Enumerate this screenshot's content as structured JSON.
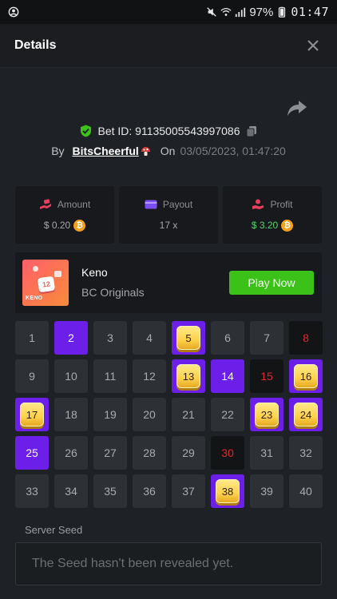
{
  "status_bar": {
    "battery": "97%",
    "time": "01:47"
  },
  "header": {
    "title": "Details"
  },
  "bet": {
    "id_text": "Bet ID: 91135005543997086",
    "by_label": "By",
    "username": "BitsCheerful",
    "on_label": "On",
    "date": "03/05/2023, 01:47:20"
  },
  "stats": {
    "amount": {
      "label": "Amount",
      "value": "$ 0.20"
    },
    "payout": {
      "label": "Payout",
      "value": "17 x"
    },
    "profit": {
      "label": "Profit",
      "value": "$ 3.20"
    },
    "coin_symbol": "₿"
  },
  "game": {
    "name": "Keno",
    "subtitle": "BC Originals",
    "thumb_text": "KENO",
    "thumb_ball_number": "12",
    "play_label": "Play Now"
  },
  "keno_grid": {
    "numbers": [
      "1",
      "2",
      "3",
      "4",
      "5",
      "6",
      "7",
      "8",
      "9",
      "10",
      "11",
      "12",
      "13",
      "14",
      "15",
      "16",
      "17",
      "18",
      "19",
      "20",
      "21",
      "22",
      "23",
      "24",
      "25",
      "26",
      "27",
      "28",
      "29",
      "30",
      "31",
      "32",
      "33",
      "34",
      "35",
      "36",
      "37",
      "38",
      "39",
      "40"
    ],
    "picked": [
      2,
      14,
      25
    ],
    "hits": [
      5,
      13,
      16,
      17,
      23,
      24,
      38
    ],
    "drawn_miss": [
      8,
      15,
      30
    ]
  },
  "server_seed": {
    "label": "Server Seed",
    "placeholder": "The Seed hasn't been revealed yet."
  },
  "colors": {
    "accent_purple": "#6c1fe9",
    "play_green": "#3bc117",
    "profit_green": "#52d46c",
    "drawn_red": "#e0262d",
    "coin_orange": "#f3a01d"
  }
}
